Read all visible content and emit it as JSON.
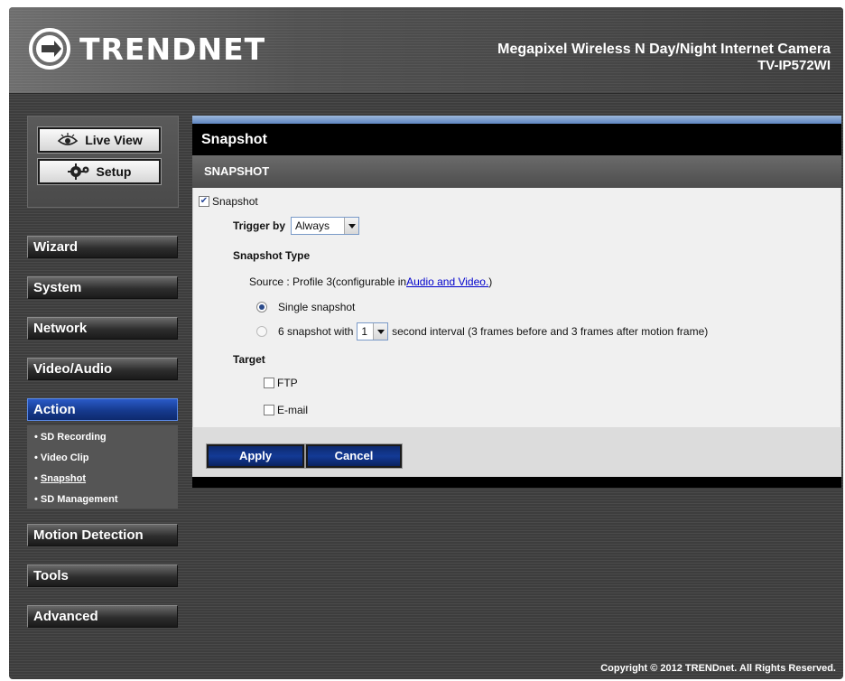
{
  "header": {
    "brand": "TRENDNET",
    "product_title": "Megapixel Wireless N Day/Night Internet Camera",
    "model": "TV-IP572WI"
  },
  "sidebar": {
    "live_view": "Live View",
    "setup": "Setup",
    "menu": [
      {
        "label": "Wizard"
      },
      {
        "label": "System"
      },
      {
        "label": "Network"
      },
      {
        "label": "Video/Audio"
      },
      {
        "label": "Action"
      },
      {
        "label": "Motion Detection"
      },
      {
        "label": "Tools"
      },
      {
        "label": "Advanced"
      }
    ],
    "action_submenu": [
      {
        "label": "SD Recording"
      },
      {
        "label": "Video Clip"
      },
      {
        "label": "Snapshot"
      },
      {
        "label": "SD Management"
      }
    ]
  },
  "main": {
    "page_title": "Snapshot",
    "section_title": "SNAPSHOT",
    "snapshot_checkbox_label": "Snapshot",
    "snapshot_checked": true,
    "trigger_label": "Trigger by",
    "trigger_value": "Always",
    "snapshot_type_label": "Snapshot Type",
    "source_text": "Source : Profile 3(configurable in ",
    "source_link": "Audio and Video.",
    "source_close": ")",
    "single_snapshot_label": "Single snapshot",
    "multi_prefix": "6 snapshot with",
    "multi_interval_value": "1",
    "multi_suffix": "second interval (3 frames before and 3 frames after motion frame)",
    "target_label": "Target",
    "ftp_label": "FTP",
    "email_label": "E-mail",
    "apply_label": "Apply",
    "cancel_label": "Cancel"
  },
  "footer": {
    "copyright": "Copyright © 2012 TRENDnet. All Rights Reserved."
  },
  "colors": {
    "active_menu": "#163a8e",
    "accent_bar": "#5f86c0",
    "link": "#0000cc"
  }
}
